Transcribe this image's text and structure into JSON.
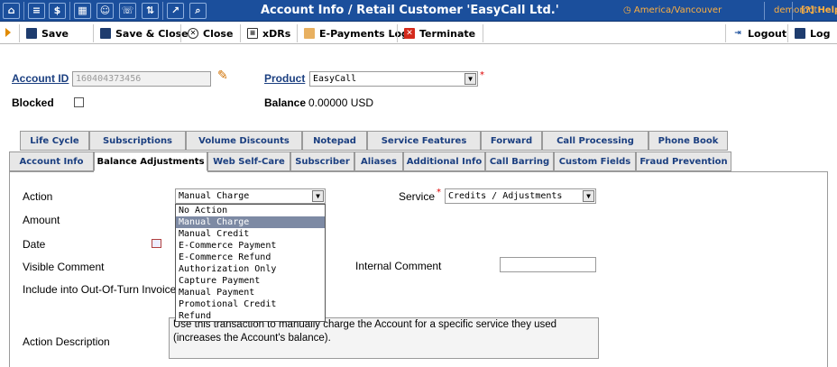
{
  "window": {
    "title": "Account Info / Retail Customer 'EasyCall Ltd.'",
    "timezone": "America/Vancouver",
    "user": "demoroot",
    "help_label": "Help"
  },
  "titlebar_icons": [
    "home-icon",
    "list-icon",
    "dollar-icon",
    "grid-icon",
    "person-icon",
    "phone-icon",
    "transfer-icon",
    "chart-icon",
    "search-icon"
  ],
  "toolbar": {
    "save_label": "Save",
    "save_close_label": "Save & Close",
    "close_label": "Close",
    "xdrs_label": "xDRs",
    "epayments_label": "E-Payments Log",
    "terminate_label": "Terminate",
    "logout_label": "Logout",
    "log_label": "Log"
  },
  "account": {
    "account_id_label": "Account ID",
    "account_id_value": "160404373456",
    "product_label": "Product",
    "product_value": "EasyCall",
    "blocked_label": "Blocked",
    "balance_label": "Balance",
    "balance_value": "0.00000 USD"
  },
  "tabs_row1": [
    "Life Cycle",
    "Subscriptions",
    "Volume Discounts",
    "Notepad",
    "Service Features",
    "Forward",
    "Call Processing",
    "Phone Book"
  ],
  "tabs_row2": [
    "Account Info",
    "Balance Adjustments",
    "Web Self-Care",
    "Subscriber",
    "Aliases",
    "Additional Info",
    "Call Barring",
    "Custom Fields",
    "Fraud Prevention"
  ],
  "active_tab": "Balance Adjustments",
  "form": {
    "action_label": "Action",
    "action_value": "Manual Charge",
    "amount_label": "Amount",
    "date_label": "Date",
    "visible_comment_label": "Visible Comment",
    "include_label": "Include into Out-Of-Turn Invoice",
    "service_label": "Service",
    "service_value": "Credits / Adjustments",
    "internal_comment_label": "Internal Comment",
    "action_description_label": "Action Description",
    "action_description_value": "Use this transaction to manually charge the Account for a specific service they used (increases the Account's balance)."
  },
  "action_options": [
    "No Action",
    "Manual Charge",
    "Manual Credit",
    "E-Commerce Payment",
    "E-Commerce Refund",
    "Authorization Only",
    "Capture Payment",
    "Manual Payment",
    "Promotional Credit",
    "Refund"
  ],
  "selected_option": "Manual Charge"
}
